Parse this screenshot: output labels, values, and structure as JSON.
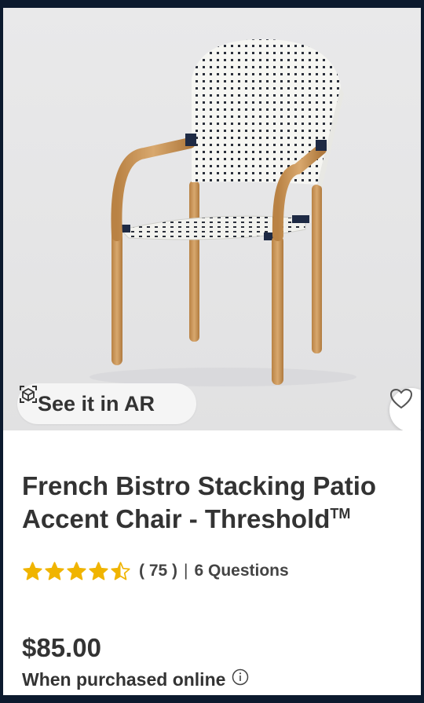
{
  "product": {
    "image_alt": "French bistro stacking patio chair",
    "ar_label": "See it in AR",
    "title_line1": "French Bistro Stacking Patio",
    "title_line2": "Accent Chair - Threshold",
    "trademark": "TM",
    "rating": 4.5,
    "rating_max": 5,
    "review_count": "( 75 )",
    "separator": "|",
    "questions": "6 Questions",
    "price": "$85.00",
    "price_note": "When purchased online"
  },
  "icons": {
    "ar": "ar-cube-icon",
    "favorite": "heart-icon",
    "info": "info-icon",
    "star": "star-icon"
  },
  "colors": {
    "star": "#f0b400",
    "text": "#333333",
    "page_border": "#0c1a2e",
    "wood": "#c9965c"
  }
}
